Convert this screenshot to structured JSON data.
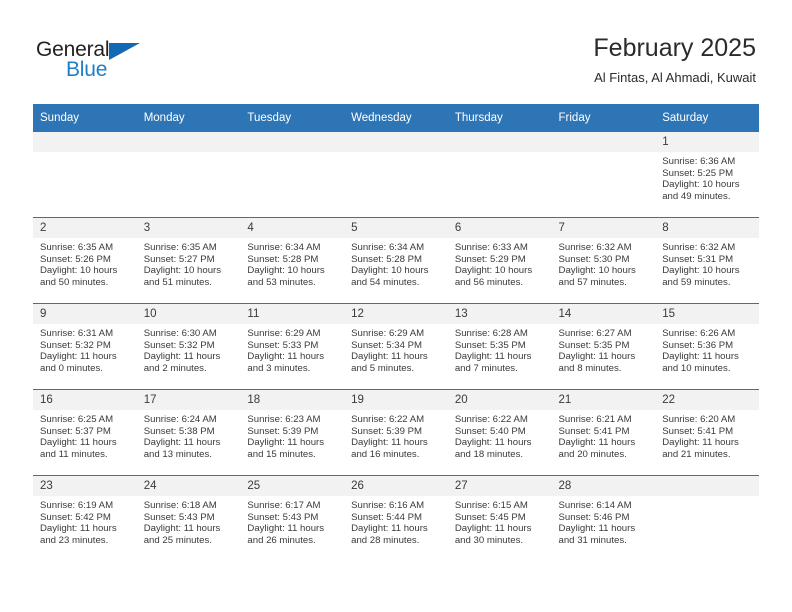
{
  "brand": {
    "name_top": "General",
    "name_bottom": "Blue",
    "triangle_color": "#1268b3",
    "top_color": "#231f20",
    "bottom_color": "#1f7fc4"
  },
  "header": {
    "title": "February 2025",
    "subtitle": "Al Fintas, Al Ahmadi, Kuwait"
  },
  "theme": {
    "header_bg": "#2e75b6",
    "header_text": "#ffffff",
    "daynum_bg": "#f2f2f2",
    "cell_bg": "#ffffff",
    "text": "#3a3a3a"
  },
  "weekdays": [
    "Sunday",
    "Monday",
    "Tuesday",
    "Wednesday",
    "Thursday",
    "Friday",
    "Saturday"
  ],
  "weeks": [
    [
      {
        "day": "",
        "sunrise": "",
        "sunset": "",
        "daylight": "",
        "empty": true
      },
      {
        "day": "",
        "sunrise": "",
        "sunset": "",
        "daylight": "",
        "empty": true
      },
      {
        "day": "",
        "sunrise": "",
        "sunset": "",
        "daylight": "",
        "empty": true
      },
      {
        "day": "",
        "sunrise": "",
        "sunset": "",
        "daylight": "",
        "empty": true
      },
      {
        "day": "",
        "sunrise": "",
        "sunset": "",
        "daylight": "",
        "empty": true
      },
      {
        "day": "",
        "sunrise": "",
        "sunset": "",
        "daylight": "",
        "empty": true
      },
      {
        "day": "1",
        "sunrise": "Sunrise: 6:36 AM",
        "sunset": "Sunset: 5:25 PM",
        "daylight": "Daylight: 10 hours and 49 minutes."
      }
    ],
    [
      {
        "day": "2",
        "sunrise": "Sunrise: 6:35 AM",
        "sunset": "Sunset: 5:26 PM",
        "daylight": "Daylight: 10 hours and 50 minutes."
      },
      {
        "day": "3",
        "sunrise": "Sunrise: 6:35 AM",
        "sunset": "Sunset: 5:27 PM",
        "daylight": "Daylight: 10 hours and 51 minutes."
      },
      {
        "day": "4",
        "sunrise": "Sunrise: 6:34 AM",
        "sunset": "Sunset: 5:28 PM",
        "daylight": "Daylight: 10 hours and 53 minutes."
      },
      {
        "day": "5",
        "sunrise": "Sunrise: 6:34 AM",
        "sunset": "Sunset: 5:28 PM",
        "daylight": "Daylight: 10 hours and 54 minutes."
      },
      {
        "day": "6",
        "sunrise": "Sunrise: 6:33 AM",
        "sunset": "Sunset: 5:29 PM",
        "daylight": "Daylight: 10 hours and 56 minutes."
      },
      {
        "day": "7",
        "sunrise": "Sunrise: 6:32 AM",
        "sunset": "Sunset: 5:30 PM",
        "daylight": "Daylight: 10 hours and 57 minutes."
      },
      {
        "day": "8",
        "sunrise": "Sunrise: 6:32 AM",
        "sunset": "Sunset: 5:31 PM",
        "daylight": "Daylight: 10 hours and 59 minutes."
      }
    ],
    [
      {
        "day": "9",
        "sunrise": "Sunrise: 6:31 AM",
        "sunset": "Sunset: 5:32 PM",
        "daylight": "Daylight: 11 hours and 0 minutes."
      },
      {
        "day": "10",
        "sunrise": "Sunrise: 6:30 AM",
        "sunset": "Sunset: 5:32 PM",
        "daylight": "Daylight: 11 hours and 2 minutes."
      },
      {
        "day": "11",
        "sunrise": "Sunrise: 6:29 AM",
        "sunset": "Sunset: 5:33 PM",
        "daylight": "Daylight: 11 hours and 3 minutes."
      },
      {
        "day": "12",
        "sunrise": "Sunrise: 6:29 AM",
        "sunset": "Sunset: 5:34 PM",
        "daylight": "Daylight: 11 hours and 5 minutes."
      },
      {
        "day": "13",
        "sunrise": "Sunrise: 6:28 AM",
        "sunset": "Sunset: 5:35 PM",
        "daylight": "Daylight: 11 hours and 7 minutes."
      },
      {
        "day": "14",
        "sunrise": "Sunrise: 6:27 AM",
        "sunset": "Sunset: 5:35 PM",
        "daylight": "Daylight: 11 hours and 8 minutes."
      },
      {
        "day": "15",
        "sunrise": "Sunrise: 6:26 AM",
        "sunset": "Sunset: 5:36 PM",
        "daylight": "Daylight: 11 hours and 10 minutes."
      }
    ],
    [
      {
        "day": "16",
        "sunrise": "Sunrise: 6:25 AM",
        "sunset": "Sunset: 5:37 PM",
        "daylight": "Daylight: 11 hours and 11 minutes."
      },
      {
        "day": "17",
        "sunrise": "Sunrise: 6:24 AM",
        "sunset": "Sunset: 5:38 PM",
        "daylight": "Daylight: 11 hours and 13 minutes."
      },
      {
        "day": "18",
        "sunrise": "Sunrise: 6:23 AM",
        "sunset": "Sunset: 5:39 PM",
        "daylight": "Daylight: 11 hours and 15 minutes."
      },
      {
        "day": "19",
        "sunrise": "Sunrise: 6:22 AM",
        "sunset": "Sunset: 5:39 PM",
        "daylight": "Daylight: 11 hours and 16 minutes."
      },
      {
        "day": "20",
        "sunrise": "Sunrise: 6:22 AM",
        "sunset": "Sunset: 5:40 PM",
        "daylight": "Daylight: 11 hours and 18 minutes."
      },
      {
        "day": "21",
        "sunrise": "Sunrise: 6:21 AM",
        "sunset": "Sunset: 5:41 PM",
        "daylight": "Daylight: 11 hours and 20 minutes."
      },
      {
        "day": "22",
        "sunrise": "Sunrise: 6:20 AM",
        "sunset": "Sunset: 5:41 PM",
        "daylight": "Daylight: 11 hours and 21 minutes."
      }
    ],
    [
      {
        "day": "23",
        "sunrise": "Sunrise: 6:19 AM",
        "sunset": "Sunset: 5:42 PM",
        "daylight": "Daylight: 11 hours and 23 minutes."
      },
      {
        "day": "24",
        "sunrise": "Sunrise: 6:18 AM",
        "sunset": "Sunset: 5:43 PM",
        "daylight": "Daylight: 11 hours and 25 minutes."
      },
      {
        "day": "25",
        "sunrise": "Sunrise: 6:17 AM",
        "sunset": "Sunset: 5:43 PM",
        "daylight": "Daylight: 11 hours and 26 minutes."
      },
      {
        "day": "26",
        "sunrise": "Sunrise: 6:16 AM",
        "sunset": "Sunset: 5:44 PM",
        "daylight": "Daylight: 11 hours and 28 minutes."
      },
      {
        "day": "27",
        "sunrise": "Sunrise: 6:15 AM",
        "sunset": "Sunset: 5:45 PM",
        "daylight": "Daylight: 11 hours and 30 minutes."
      },
      {
        "day": "28",
        "sunrise": "Sunrise: 6:14 AM",
        "sunset": "Sunset: 5:46 PM",
        "daylight": "Daylight: 11 hours and 31 minutes."
      },
      {
        "day": "",
        "sunrise": "",
        "sunset": "",
        "daylight": "",
        "empty": true
      }
    ]
  ]
}
